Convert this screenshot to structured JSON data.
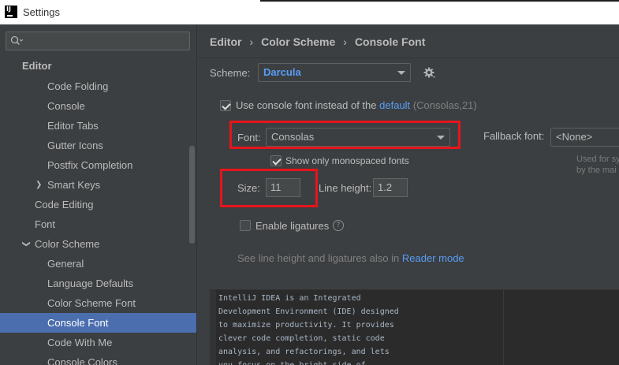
{
  "window": {
    "title": "Settings",
    "app_icon_text": "IJ"
  },
  "sidebar": {
    "search_placeholder": "",
    "items": [
      {
        "label": "Editor",
        "level": 0
      },
      {
        "label": "Code Folding",
        "level": 2
      },
      {
        "label": "Console",
        "level": 2
      },
      {
        "label": "Editor Tabs",
        "level": 2
      },
      {
        "label": "Gutter Icons",
        "level": 2
      },
      {
        "label": "Postfix Completion",
        "level": 2
      },
      {
        "label": "Smart Keys",
        "level": 2,
        "arrow": "collapsed"
      },
      {
        "label": "Code Editing",
        "level": 1
      },
      {
        "label": "Font",
        "level": 1
      },
      {
        "label": "Color Scheme",
        "level": 1,
        "arrow": "expanded"
      },
      {
        "label": "General",
        "level": 2
      },
      {
        "label": "Language Defaults",
        "level": 2
      },
      {
        "label": "Color Scheme Font",
        "level": 2
      },
      {
        "label": "Console Font",
        "level": 2,
        "selected": true
      },
      {
        "label": "Code With Me",
        "level": 2
      },
      {
        "label": "Console Colors",
        "level": 2
      }
    ]
  },
  "breadcrumb": {
    "part1": "Editor",
    "part2": "Color Scheme",
    "part3": "Console Font",
    "separator": "›"
  },
  "scheme": {
    "label": "Scheme:",
    "value": "Darcula",
    "gear_icon": "gear-icon"
  },
  "use_console_font": {
    "checked": true,
    "label": "Use console font instead of the",
    "link": "default",
    "hint": "(Consolas,21)"
  },
  "font": {
    "label": "Font:",
    "value": "Consolas"
  },
  "fallback": {
    "label": "Fallback font:",
    "value": "<None>",
    "hint_line1": "Used for sy",
    "hint_line2": "by the mai"
  },
  "monospaced": {
    "checked": true,
    "label": "Show only monospaced fonts"
  },
  "size": {
    "label": "Size:",
    "value": "11"
  },
  "line_height": {
    "label": "Line height:",
    "value": "1.2"
  },
  "ligatures": {
    "checked": false,
    "label": "Enable ligatures",
    "help_icon": "help-icon"
  },
  "note": {
    "text": "See line height and ligatures also in",
    "link": "Reader mode"
  },
  "preview": {
    "lines": [
      "IntelliJ IDEA is an Integrated",
      "Development Environment (IDE) designed",
      "to maximize productivity. It provides",
      "clever code completion, static code",
      "analysis, and refactorings, and lets",
      "you focus on the bright side of"
    ]
  },
  "colors": {
    "accent": "#4b6eaf",
    "link": "#589df6",
    "highlight_box": "#e6141b",
    "panel": "#3c3f41",
    "editor_bg": "#2b2b2b"
  }
}
